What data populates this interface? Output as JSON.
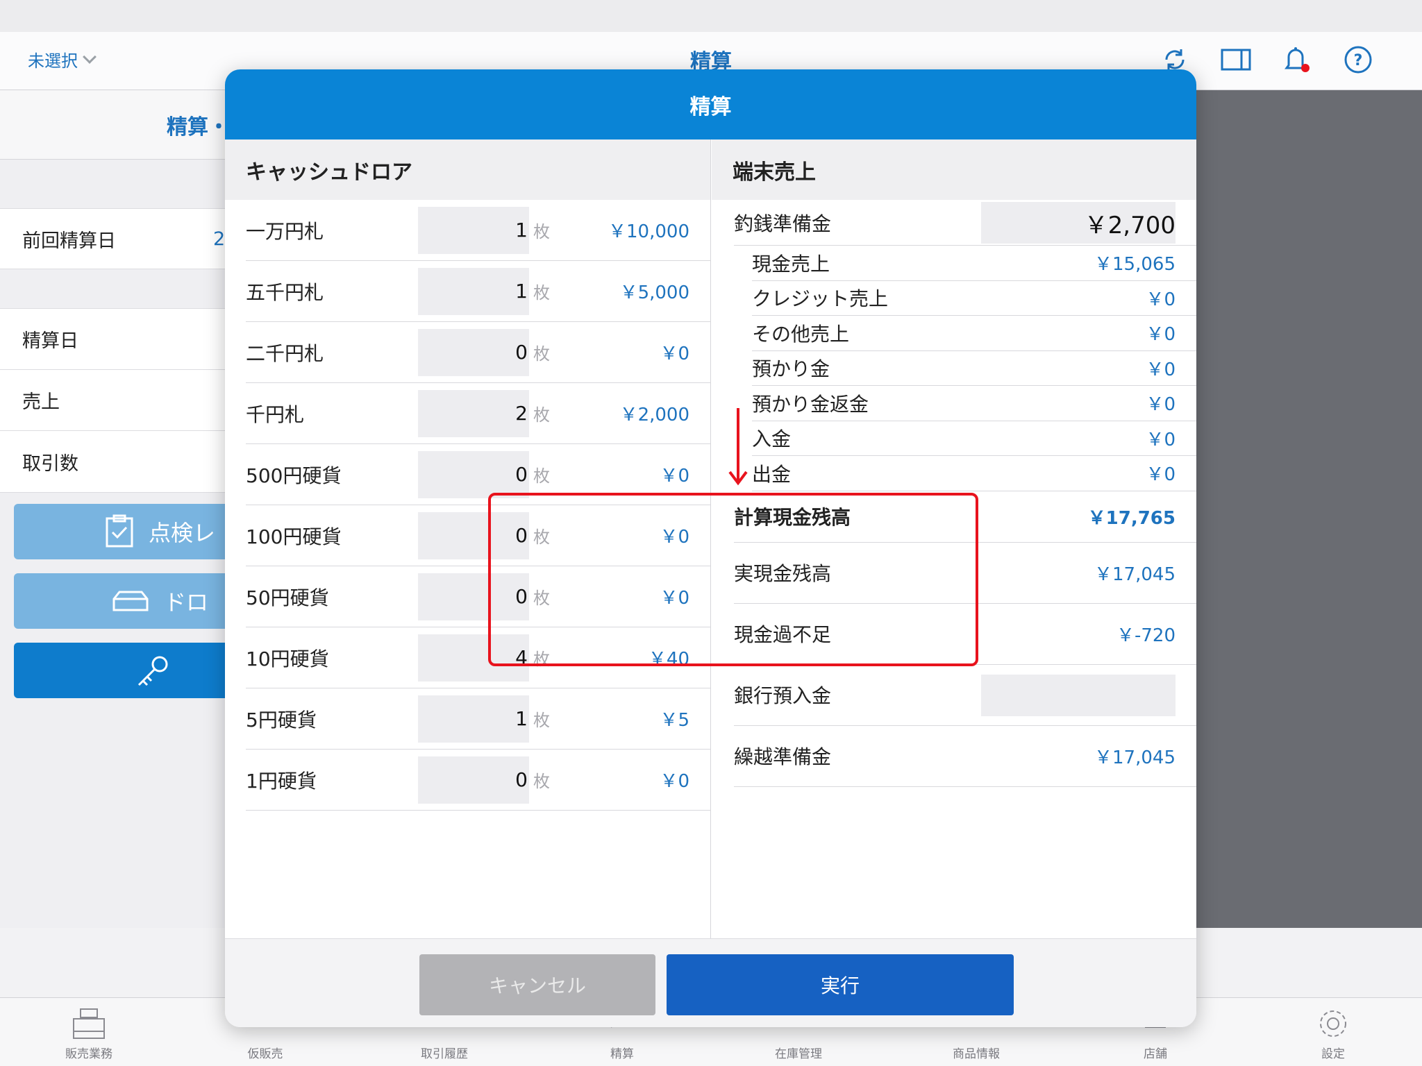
{
  "header": {
    "store_select": "未選択",
    "title": "精算"
  },
  "left_pane": {
    "title": "精算・",
    "last_settlement_label": "前回精算日",
    "last_settlement_value": "2",
    "rows": [
      "精算日",
      "売上",
      "取引数"
    ],
    "buttons": [
      "点検レ",
      "ドロ",
      ""
    ]
  },
  "modal": {
    "title": "精算",
    "cash_drawer": {
      "heading": "キャッシュドロア",
      "unit": "枚",
      "rows": [
        {
          "label": "一万円札",
          "count": "1",
          "amount": "￥10,000"
        },
        {
          "label": "五千円札",
          "count": "1",
          "amount": "￥5,000"
        },
        {
          "label": "二千円札",
          "count": "0",
          "amount": "￥0"
        },
        {
          "label": "千円札",
          "count": "2",
          "amount": "￥2,000"
        },
        {
          "label": "500円硬貨",
          "count": "0",
          "amount": "￥0"
        },
        {
          "label": "100円硬貨",
          "count": "0",
          "amount": "￥0"
        },
        {
          "label": "50円硬貨",
          "count": "0",
          "amount": "￥0"
        },
        {
          "label": "10円硬貨",
          "count": "4",
          "amount": "￥40"
        },
        {
          "label": "5円硬貨",
          "count": "1",
          "amount": "￥5"
        },
        {
          "label": "1円硬貨",
          "count": "0",
          "amount": "￥0"
        }
      ]
    },
    "terminal_sales": {
      "heading": "端末売上",
      "change_fund_label": "釣銭準備金",
      "change_fund_value": "￥2,700",
      "rows": [
        {
          "label": "現金売上",
          "amount": "￥15,065"
        },
        {
          "label": "クレジット売上",
          "amount": "￥0"
        },
        {
          "label": "その他売上",
          "amount": "￥0"
        },
        {
          "label": "預かり金",
          "amount": "￥0"
        },
        {
          "label": "預かり金返金",
          "amount": "￥0"
        },
        {
          "label": "入金",
          "amount": "￥0"
        },
        {
          "label": "出金",
          "amount": "￥0"
        }
      ],
      "calculated_balance_label": "計算現金残高",
      "calculated_balance_value": "￥17,765",
      "actual_balance_label": "実現金残高",
      "actual_balance_value": "￥17,045",
      "difference_label": "現金過不足",
      "difference_value": "￥-720",
      "bank_deposit_label": "銀行預入金",
      "carryover_label": "繰越準備金",
      "carryover_value": "￥17,045"
    },
    "footer": {
      "cancel_label": "キャンセル",
      "execute_label": "実行"
    }
  },
  "tabbar": {
    "items": [
      "販売業務",
      "仮販売",
      "取引履歴",
      "精算",
      "在庫管理",
      "商品情報",
      "店舗",
      "設定"
    ]
  },
  "colors": {
    "accent": "#0a84d6",
    "link": "#1e73be",
    "highlight": "#e8131d",
    "execute": "#1661c2"
  }
}
